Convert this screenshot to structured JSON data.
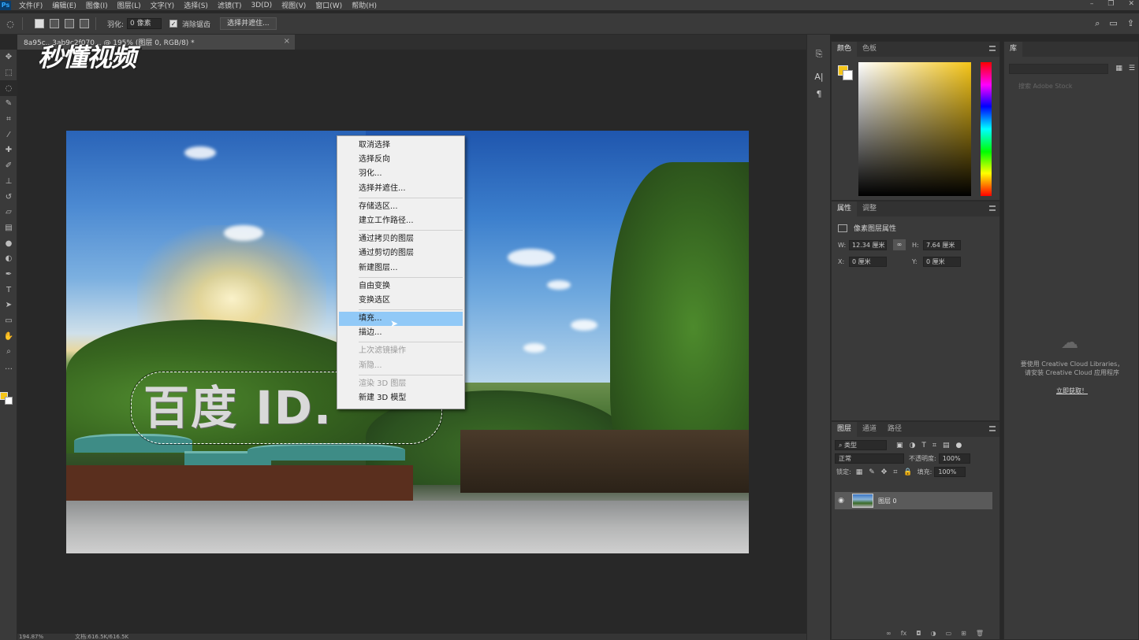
{
  "app": {
    "logo": "Ps"
  },
  "menubar": {
    "items": [
      "文件(F)",
      "编辑(E)",
      "图像(I)",
      "图层(L)",
      "文字(Y)",
      "选择(S)",
      "滤镜(T)",
      "3D(D)",
      "视图(V)",
      "窗口(W)",
      "帮助(H)"
    ]
  },
  "options": {
    "feather_label": "羽化:",
    "feather_value": "0 像素",
    "antialias_label": "消除锯齿",
    "select_mask_button": "选择并遮住..."
  },
  "document": {
    "tab_title": "8a95c...3ab9c2f070... @ 195% (图层 0, RGB/8) *",
    "canvas_text": "百度 ID."
  },
  "watermark": "秒懂视频",
  "context_menu": {
    "groups": [
      [
        {
          "label": "取消选择"
        },
        {
          "label": "选择反向"
        },
        {
          "label": "羽化..."
        },
        {
          "label": "选择并遮住..."
        }
      ],
      [
        {
          "label": "存储选区..."
        },
        {
          "label": "建立工作路径..."
        }
      ],
      [
        {
          "label": "通过拷贝的图层"
        },
        {
          "label": "通过剪切的图层"
        },
        {
          "label": "新建图层..."
        }
      ],
      [
        {
          "label": "自由变换"
        },
        {
          "label": "变换选区"
        }
      ],
      [
        {
          "label": "填充...",
          "highlighted": true
        },
        {
          "label": "描边..."
        }
      ],
      [
        {
          "label": "上次滤镜操作",
          "disabled": true
        },
        {
          "label": "渐隐...",
          "disabled": true
        }
      ],
      [
        {
          "label": "渲染 3D 图层",
          "disabled": true
        },
        {
          "label": "新建 3D 模型"
        }
      ]
    ]
  },
  "status": {
    "zoom": "194.87%",
    "doc_size": "文档:616.5K/616.5K"
  },
  "color_panel": {
    "tabs": [
      "颜色",
      "色板"
    ],
    "foreground": "#f5c518",
    "background": "#ffffff"
  },
  "properties_panel": {
    "tabs": [
      "属性",
      "调整"
    ],
    "title": "像素图层属性",
    "w_label": "W:",
    "w_value": "12.34 厘米",
    "h_label": "H:",
    "h_value": "7.64 厘米",
    "x_label": "X:",
    "x_value": "0 厘米",
    "y_label": "Y:",
    "y_value": "0 厘米"
  },
  "layers_panel": {
    "tabs": [
      "图层",
      "通道",
      "路径"
    ],
    "filter_kind": "类型",
    "blend_mode": "正常",
    "opacity_label": "不透明度:",
    "opacity_value": "100%",
    "lock_label": "锁定:",
    "fill_label": "填充:",
    "fill_value": "100%",
    "layer_name": "图层 0"
  },
  "library_panel": {
    "tab": "库",
    "search_placeholder": "搜索 Adobe Stock",
    "message_line1": "要使用 Creative Cloud Libraries，",
    "message_line2": "请安装 Creative Cloud 应用程序",
    "link": "立即获取！"
  }
}
